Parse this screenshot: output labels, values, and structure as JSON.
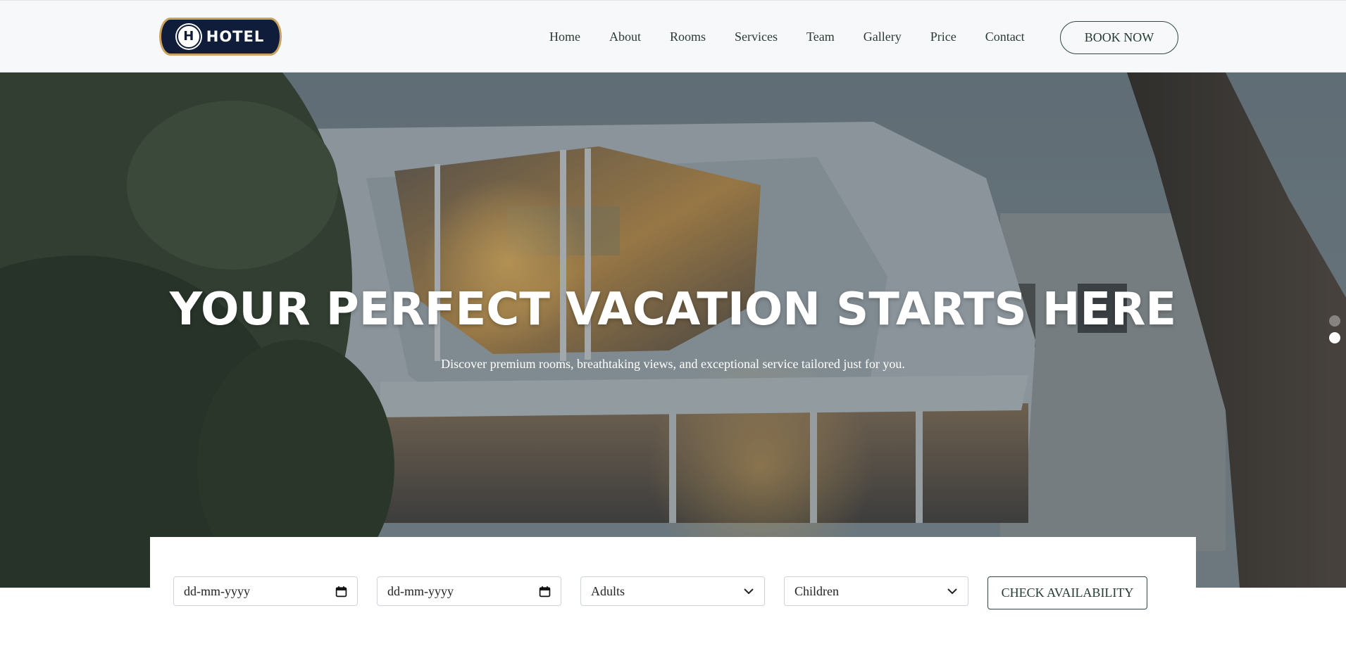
{
  "brand": {
    "logo_mark": "H",
    "logo_text": "HOTEL",
    "logo_icon": "hotel-logo-icon"
  },
  "nav": {
    "items": [
      {
        "label": "Home"
      },
      {
        "label": "About"
      },
      {
        "label": "Rooms"
      },
      {
        "label": "Services"
      },
      {
        "label": "Team"
      },
      {
        "label": "Gallery"
      },
      {
        "label": "Price"
      },
      {
        "label": "Contact"
      }
    ],
    "cta_label": "BOOK NOW"
  },
  "hero": {
    "title": "YOUR PERFECT VACATION STARTS HERE",
    "subtitle": "Discover premium rooms, breathtaking views, and exceptional service tailored just for you.",
    "slides": [
      {
        "active": false
      },
      {
        "active": true
      }
    ]
  },
  "booking": {
    "check_in": {
      "placeholder": "dd-mm-yyyy",
      "icon": "calendar-icon"
    },
    "check_out": {
      "placeholder": "dd-mm-yyyy",
      "icon": "calendar-icon"
    },
    "adults": {
      "value": "Adults",
      "icon": "chevron-down-icon"
    },
    "children": {
      "value": "Children",
      "icon": "chevron-down-icon"
    },
    "submit_label": "CHECK AVAILABILITY"
  },
  "colors": {
    "navbar_bg": "#f7f8fa",
    "logo_bg": "#0f1d3a",
    "logo_border": "#c9a35e",
    "accent_border": "#2f4a3d",
    "nav_text": "#2a3a33"
  }
}
